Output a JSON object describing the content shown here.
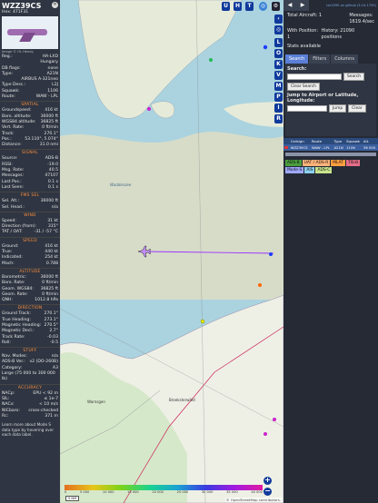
{
  "aircraft": {
    "callsign": "WZZ39CS",
    "hex_label": "Hex:",
    "hex": "471F31",
    "photo_caption": "Image © OL Hendy",
    "general": [
      {
        "k": "Reg.:",
        "v": "HA-LXD"
      },
      {
        "k": "",
        "v": "Hungary"
      },
      {
        "k": "DB flags:",
        "v": "none"
      },
      {
        "k": "Type:",
        "v": "A21N"
      },
      {
        "k": "",
        "v": "AIRBUS A-321neo"
      },
      {
        "k": "Type Desc.:",
        "v": "L2J"
      },
      {
        "k": "Squawk:",
        "v": "1106"
      },
      {
        "k": "Route:",
        "v": "WAW - LPL"
      }
    ],
    "spatial_title": "SPATIAL",
    "spatial": [
      {
        "k": "Groundspeed:",
        "v": "416 kt"
      },
      {
        "k": "Baro. altitude:",
        "v": "36000 ft"
      },
      {
        "k": "WGS84 altitude:",
        "v": "36825 ft"
      },
      {
        "k": "Vert. Rate:",
        "v": "0 ft/min"
      },
      {
        "k": "Track:",
        "v": "270.1°"
      },
      {
        "k": "Pos.:",
        "v": "53.110°, 5.074°"
      },
      {
        "k": "Distance:",
        "v": "31.0 nmi"
      }
    ],
    "signal_title": "SIGNAL",
    "signal": [
      {
        "k": "Source:",
        "v": "ADS-B"
      },
      {
        "k": "RSSI:",
        "v": "-19.0"
      },
      {
        "k": "Msg. Rate:",
        "v": "40.5"
      },
      {
        "k": "Messages:",
        "v": "47107"
      },
      {
        "k": "Last Pos.:",
        "v": "0.1 s"
      },
      {
        "k": "Last Seen:",
        "v": "0.1 s"
      }
    ],
    "fms_title": "FMS SEL",
    "fms": [
      {
        "k": "Sel. Alt.:",
        "v": "36000 ft"
      },
      {
        "k": "Sel. Head.:",
        "v": "n/a"
      }
    ],
    "wind_title": "WIND",
    "wind": [
      {
        "k": "Speed:",
        "v": "31 kt"
      },
      {
        "k": "Direction (from):",
        "v": "315°"
      },
      {
        "k": "TAT / OAT:",
        "v": "-31 / -57 °C"
      }
    ],
    "speed_title": "SPEED",
    "speed": [
      {
        "k": "Ground:",
        "v": "416 kt"
      },
      {
        "k": "True:",
        "v": "440 kt"
      },
      {
        "k": "Indicated:",
        "v": "254 kt"
      },
      {
        "k": "Mach:",
        "v": "0.788"
      }
    ],
    "altitude_title": "ALTITUDE",
    "altitude": [
      {
        "k": "Barometric:",
        "v": "36000 ft"
      },
      {
        "k": "Baro. Rate:",
        "v": "0 ft/min"
      },
      {
        "k": "Geom. WGS84:",
        "v": "36825 ft"
      },
      {
        "k": "Geom. Rate:",
        "v": "0 ft/min"
      },
      {
        "k": "QNH:",
        "v": "1012.8 hPa"
      }
    ],
    "direction_title": "DIRECTION",
    "direction": [
      {
        "k": "Ground Track:",
        "v": "270.1°"
      },
      {
        "k": "True Heading:",
        "v": "273.1°"
      },
      {
        "k": "Magnetic Heading:",
        "v": "270.5°"
      },
      {
        "k": "Magnetic Decl.:",
        "v": "2.7°"
      },
      {
        "k": "Track Rate:",
        "v": "-0.03"
      },
      {
        "k": "Roll:",
        "v": "-0.5"
      }
    ],
    "stuff_title": "STUFF",
    "stuff": [
      {
        "k": "Nav. Modes:",
        "v": "n/a"
      },
      {
        "k": "ADS-B Ver.:",
        "v": "v2 (DO-260B)"
      },
      {
        "k": "Category:",
        "v": "A3"
      },
      {
        "k": "Large (75 000 to 300 000 lb)",
        "v": ""
      }
    ],
    "accuracy_title": "ACCURACY",
    "accuracy": [
      {
        "k": "NACp:",
        "v": "EPU < 92 m"
      },
      {
        "k": "SIL:",
        "v": "≤ 1e-7"
      },
      {
        "k": "NACv:",
        "v": "< 10 m/s"
      },
      {
        "k": "NICbaro:",
        "v": "cross-checked"
      },
      {
        "k": "Rc:",
        "v": "371 m"
      }
    ],
    "footer": "Learn more about Mode S data type by hovering over each data label."
  },
  "map_buttons": {
    "u": "U",
    "h": "H",
    "t": "T"
  },
  "side_buttons": [
    "L",
    "O",
    "K",
    "V",
    "M",
    "P",
    "I",
    "R"
  ],
  "map_labels": {
    "city1": "Warnsgen",
    "city2": "Broeksterwâld",
    "sea": "Waddenzee"
  },
  "legend_ticks": [
    "0",
    "5 000",
    "10 000",
    "15 000",
    "20 000",
    "25 000",
    "30 000",
    "35 000",
    "40 000"
  ],
  "scale": "5 NM",
  "attribution": "© OpenStreetMap contributors.",
  "right_panel": {
    "link": "tar1090 on github (3.14.1755)",
    "total_label": "Total Aircraft:",
    "total": "1",
    "messages_label": "Messages:",
    "messages": "1619.4/sec",
    "with_pos_label": "With Position:",
    "with_pos": "1",
    "history_label": "History:",
    "history": "21090 positions",
    "stats_label": "Stats available",
    "tabs": [
      "Search",
      "Filters",
      "Columns"
    ],
    "search_label": "Search:",
    "search_button": "Search",
    "clear_search": "Clear Search",
    "jump_label": "Jump to Airport or Latitude, Longitude:",
    "jump_button": "Jump",
    "clear_button": "Clear",
    "table_headers": [
      "",
      "Callsign",
      "Route",
      "Type",
      "Squawk",
      "Alt."
    ],
    "rows": [
      [
        "",
        "WZZ39CS",
        "WAW - LPL",
        "A21N",
        "1106",
        "36 000"
      ]
    ],
    "chips": [
      {
        "label": "ADS-B",
        "color": "#4a9e3f"
      },
      {
        "label": "UAT / ADS-R",
        "color": "#ffb37a"
      },
      {
        "label": "MLAT",
        "color": "#ff9f40"
      },
      {
        "label": "TIS-B",
        "color": "#e46d88"
      },
      {
        "label": "Mode-S",
        "color": "#a0a8ff"
      },
      {
        "label": "AIS",
        "color": "#8cd0f0"
      },
      {
        "label": "ADS-C",
        "color": "#c8e48c"
      }
    ]
  },
  "colors": {
    "track": "#9b30ff",
    "accent": "#103a9c",
    "section": "#ff8f3d"
  }
}
